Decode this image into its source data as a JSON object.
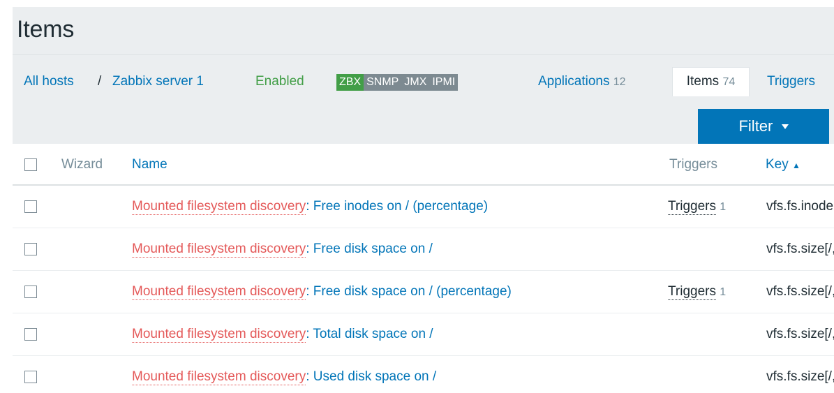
{
  "page": {
    "title": "Items"
  },
  "nav": {
    "all_hosts": "All hosts",
    "separator": "/",
    "host": "Zabbix server 1",
    "status": "Enabled",
    "availability": [
      "ZBX",
      "SNMP",
      "JMX",
      "IPMI"
    ],
    "applications": {
      "label": "Applications",
      "count": "12"
    },
    "items": {
      "label": "Items",
      "count": "74"
    },
    "triggers": {
      "label": "Triggers"
    }
  },
  "filter": {
    "label": "Filter",
    "icon": "caret-down-icon"
  },
  "table": {
    "columns": {
      "wizard": "Wizard",
      "name": "Name",
      "triggers": "Triggers",
      "key": "Key",
      "key_sort": "▲"
    },
    "rows": [
      {
        "rule": "Mounted filesystem discovery",
        "name": ": Free inodes on / (percentage)",
        "triggers": "Triggers",
        "triggers_count": "1",
        "key": "vfs.fs.inode[/,pfree]"
      },
      {
        "rule": "Mounted filesystem discovery",
        "name": ": Free disk space on /",
        "triggers": "",
        "triggers_count": "",
        "key": "vfs.fs.size[/,free]"
      },
      {
        "rule": "Mounted filesystem discovery",
        "name": ": Free disk space on / (percentage)",
        "triggers": "Triggers",
        "triggers_count": "1",
        "key": "vfs.fs.size[/,pfree]"
      },
      {
        "rule": "Mounted filesystem discovery",
        "name": ": Total disk space on /",
        "triggers": "",
        "triggers_count": "",
        "key": "vfs.fs.size[/,total]"
      },
      {
        "rule": "Mounted filesystem discovery",
        "name": ": Used disk space on /",
        "triggers": "",
        "triggers_count": "",
        "key": "vfs.fs.size[/,used]"
      }
    ]
  },
  "colors": {
    "link": "#0275b8",
    "enabled": "#429e47",
    "rule_link": "#e45959",
    "available": "#429e47",
    "unknown": "#7d8a91",
    "filter_bg": "#0275b8",
    "page_bg": "#ebeef0"
  }
}
